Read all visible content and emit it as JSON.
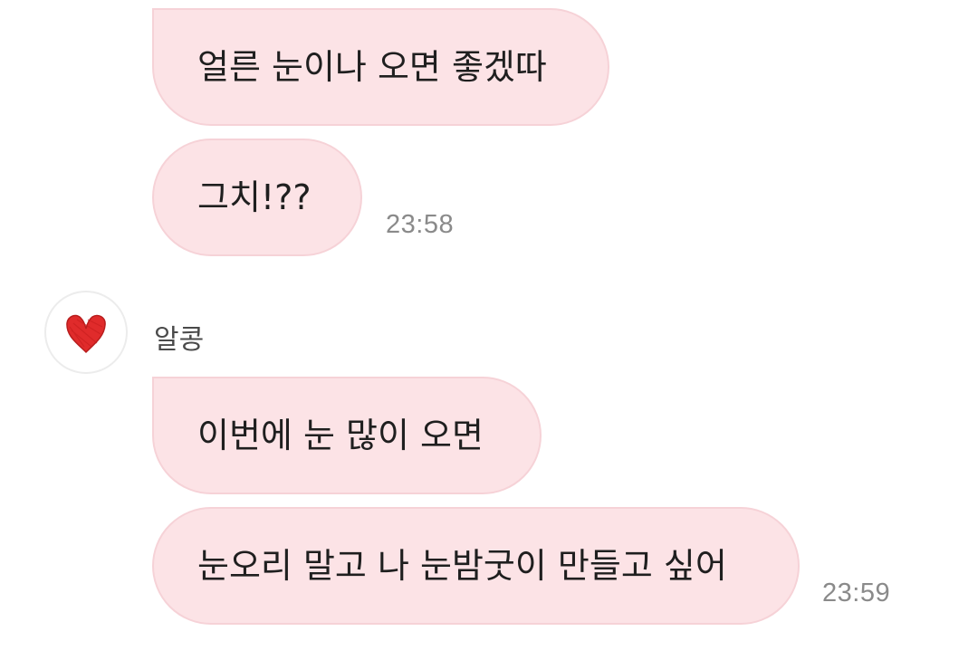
{
  "colors": {
    "bubble_bg": "#fce3e6",
    "bubble_border": "#f6d2d7",
    "timestamp": "#8a8a8a",
    "heart": "#e02b2b"
  },
  "messages_group_1": [
    {
      "text": "얼른 눈이나 오면 좋겠따"
    },
    {
      "text": "그치!??",
      "time": "23:58"
    }
  ],
  "sender": {
    "name": "알콩",
    "avatar_icon": "red-heart-icon"
  },
  "messages_group_2": [
    {
      "text": "이번에 눈 많이 오면"
    },
    {
      "text": "눈오리 말고 나 눈밤굿이 만들고 싶어",
      "time": "23:59"
    }
  ]
}
